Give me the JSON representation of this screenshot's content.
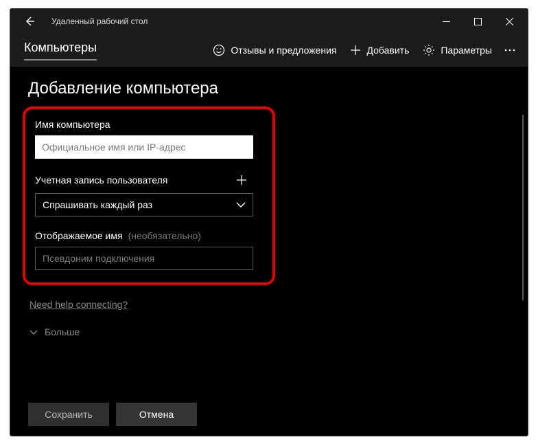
{
  "titlebar": {
    "app_title": "Удаленный рабочий стол"
  },
  "toolbar": {
    "tab_label": "Компьютеры",
    "feedback_label": "Отзывы и предложения",
    "add_label": "Добавить",
    "settings_label": "Параметры"
  },
  "page": {
    "heading": "Добавление компьютера"
  },
  "form": {
    "computer_name_label": "Имя компьютера",
    "computer_name_placeholder": "Официальное имя или IP-адрес",
    "user_account_label": "Учетная запись пользователя",
    "user_account_value": "Спрашивать каждый раз",
    "display_name_label": "Отображаемое имя",
    "display_name_optional": "(необязательно)",
    "display_name_placeholder": "Псевдоним подключения"
  },
  "help_link": "Need help connecting?",
  "expand_label": "Больше",
  "buttons": {
    "save": "Сохранить",
    "cancel": "Отмена"
  }
}
